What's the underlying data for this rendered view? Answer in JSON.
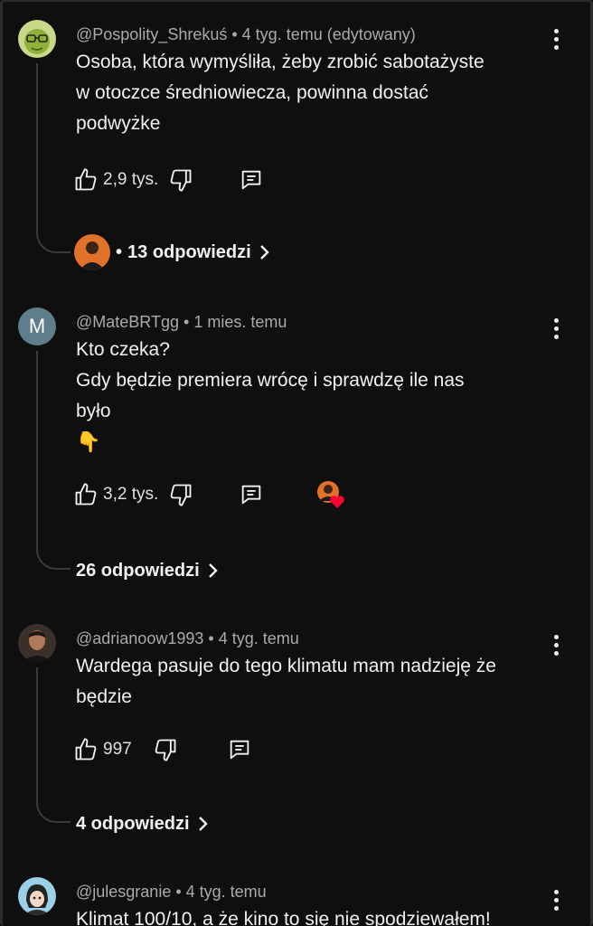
{
  "comments": [
    {
      "author": "@Pospolity_Shrekuś",
      "time": "4 tyg. temu (edytowany)",
      "lines": [
        "Osoba, która wymyśliła, żeby zrobić sabotażyste",
        "w otoczce średniowiecza, powinna dostać",
        "podwyżke"
      ],
      "likes": "2,9 tys.",
      "replies": "13 odpowiedzi",
      "avatar_icon": "shrek-avatar"
    },
    {
      "author": "@MateBRTgg",
      "time": "1 mies. temu",
      "avatar_letter": "M",
      "lines": [
        "Kto czeka?",
        "Gdy będzie premiera wrócę i sprawdzę ile nas",
        "było",
        "👇"
      ],
      "likes": "3,2 tys.",
      "replies": "26 odpowiedzi",
      "creator_heart": true
    },
    {
      "author": "@adrianoow1993",
      "time": "4 tyg. temu",
      "lines": [
        "Wardega pasuje do tego klimatu mam nadzieję że",
        "będzie"
      ],
      "likes": "997",
      "replies": "4 odpowiedzi",
      "avatar_icon": "man-avatar"
    },
    {
      "author": "@julesgranie",
      "time": "4 tyg. temu",
      "lines": [
        "Klimat 100/10, a że kino to się nie spodziewałem!"
      ],
      "avatar_icon": "cartoon-avatar"
    }
  ],
  "separator": "•",
  "colors": {
    "background": "#0f0f0f",
    "text": "#f1f1f1",
    "meta": "#aaaaaa",
    "heart": "#ff0033",
    "avatar_m": "#607d8b"
  }
}
